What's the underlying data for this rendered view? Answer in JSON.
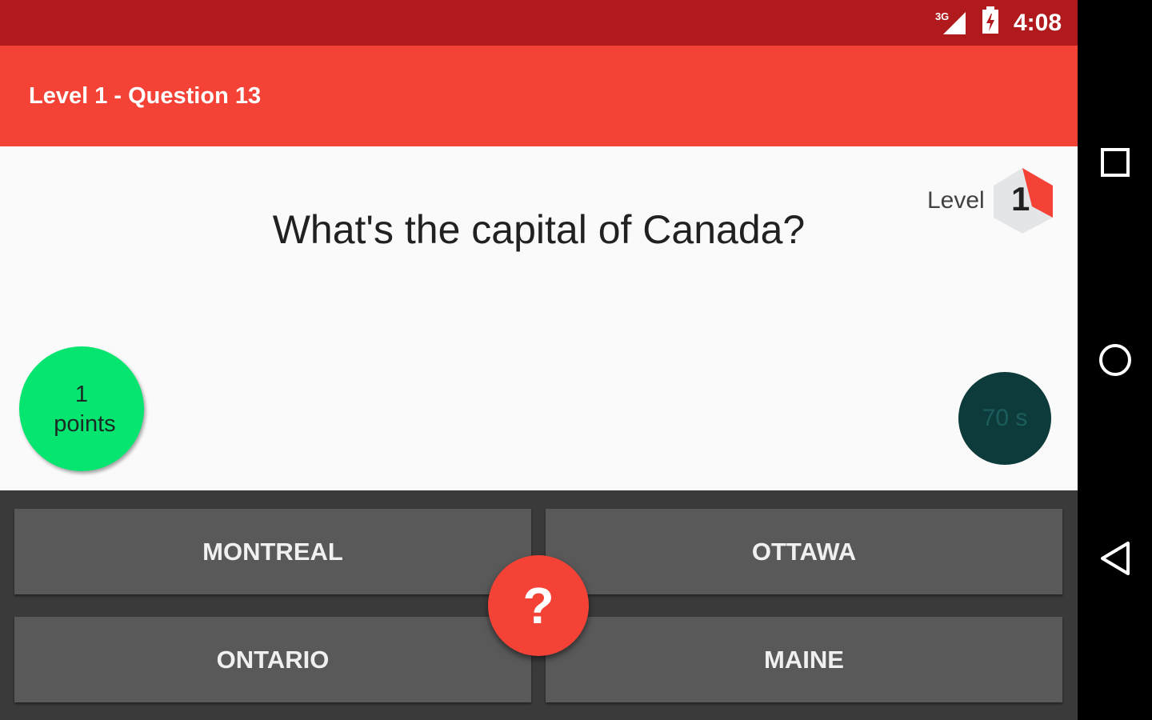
{
  "status_bar": {
    "network_label": "3G",
    "time": "4:08",
    "icons": [
      "signal-icon",
      "battery-charging-icon"
    ]
  },
  "toolbar": {
    "title": "Level 1 - Question 13"
  },
  "question": {
    "text": "What's the capital of Canada?"
  },
  "level": {
    "label": "Level",
    "number": "1"
  },
  "score": {
    "value": "1",
    "unit": "points"
  },
  "timer": {
    "text": "70 s"
  },
  "answers": [
    {
      "label": "MONTREAL"
    },
    {
      "label": "OTTAWA"
    },
    {
      "label": "ONTARIO"
    },
    {
      "label": "MAINE"
    }
  ],
  "hint_button": {
    "label": "?"
  },
  "navigation": {
    "icons": [
      "recents-icon",
      "home-icon",
      "back-icon"
    ]
  },
  "colors": {
    "status_bar": "#b01a1d",
    "toolbar": "#f44336",
    "points_badge": "#06e570",
    "timer_badge": "#0d3b3b",
    "answer_button": "#595959",
    "answers_background": "#3a3a3a"
  }
}
